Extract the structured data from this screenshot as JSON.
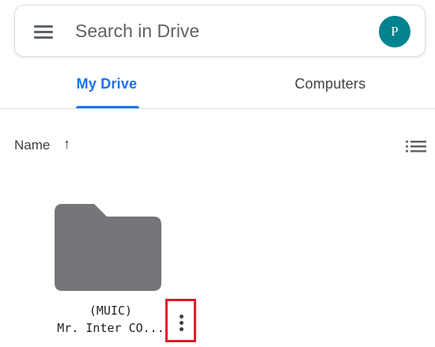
{
  "search_bar": {
    "placeholder": "Search in Drive",
    "menu_icon": "menu-icon",
    "avatar_initial": "P",
    "avatar_color": "#00838f"
  },
  "tabs": [
    {
      "label": "My Drive",
      "active": true
    },
    {
      "label": "Computers",
      "active": false
    }
  ],
  "accent_color": "#1a73e8",
  "sort": {
    "label": "Name",
    "direction_icon": "arrow-up-icon",
    "direction_glyph": "↑",
    "view_toggle_icon": "list-view-icon"
  },
  "files": [
    {
      "type": "folder",
      "icon": "folder-icon",
      "name_line1": "(MUIC)",
      "name_line2": "Mr. Inter CO...",
      "more_icon": "more-vert-icon",
      "highlight_color": "#e01b24"
    }
  ]
}
